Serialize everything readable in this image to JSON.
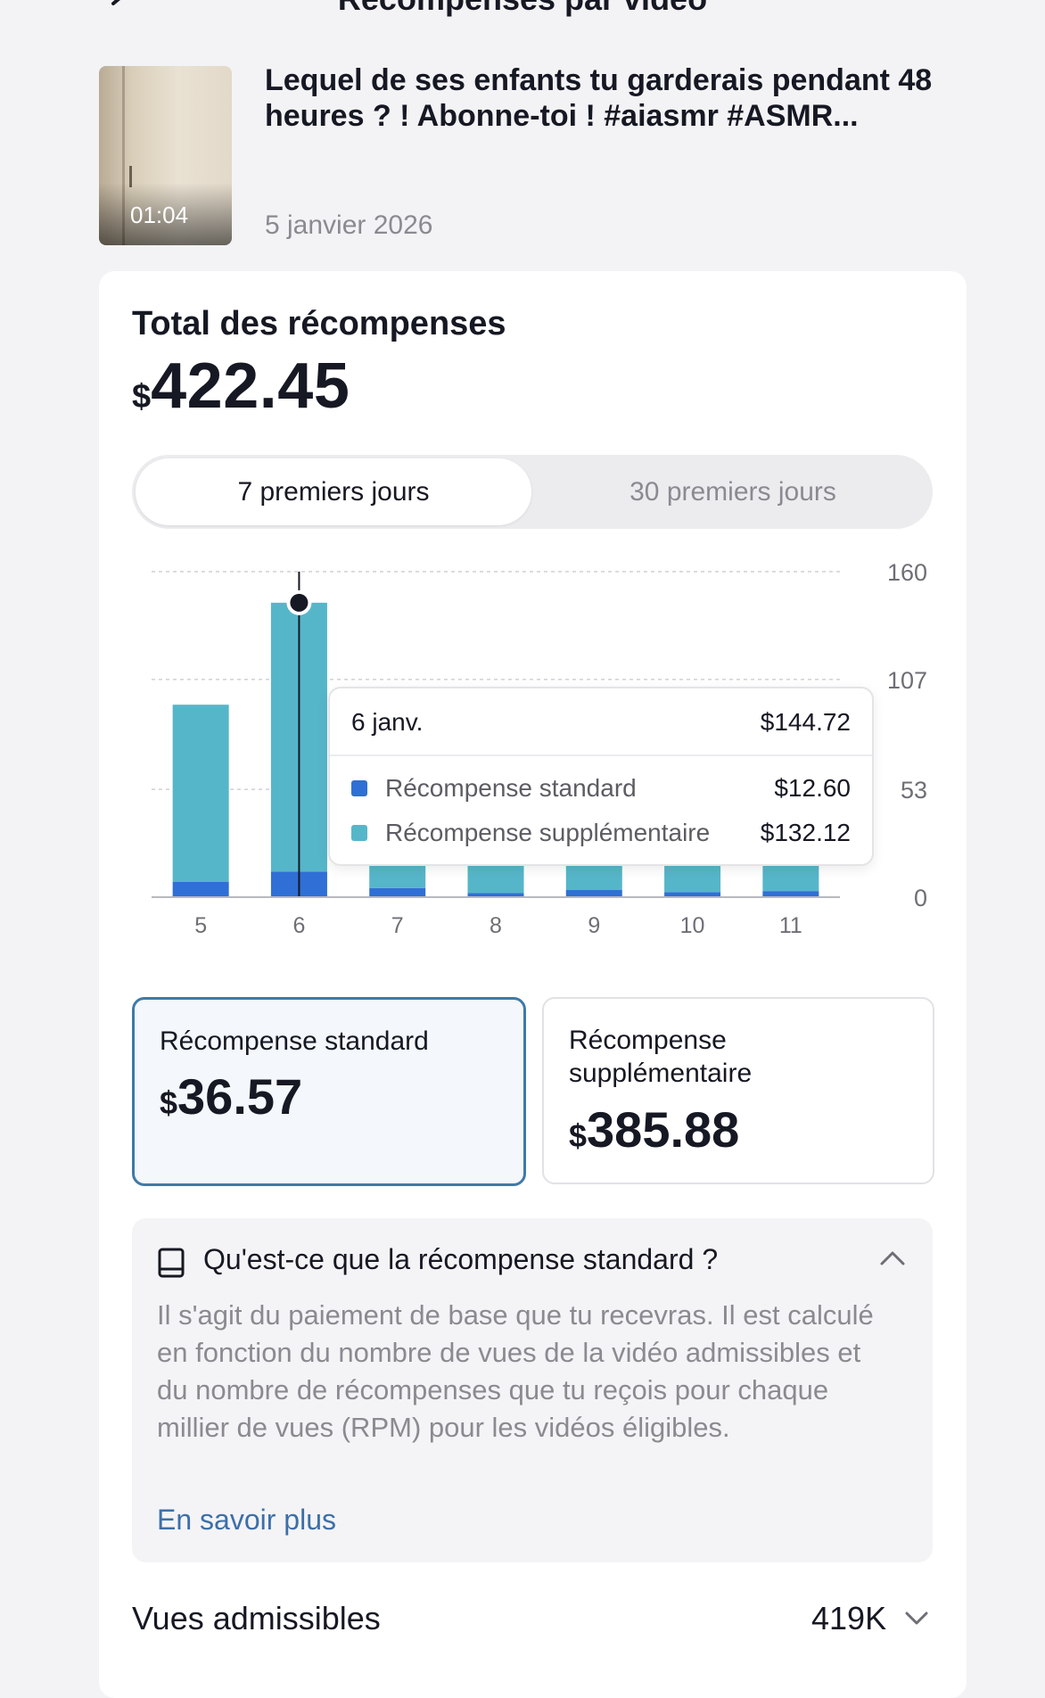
{
  "header": {
    "title": "Récompenses par vidéo"
  },
  "video": {
    "duration": "01:04",
    "title": "Lequel de ses enfants tu garderais pendant 48 heures ? ! Abonne-toi ! #aiasmr #ASMR...",
    "date": "5 janvier 2026"
  },
  "total": {
    "label": "Total des récompenses",
    "currency": "$",
    "amount": "422.45"
  },
  "tabs": {
    "first": "7 premiers jours",
    "second": "30 premiers jours",
    "selected": "7 premiers jours"
  },
  "chart_data": {
    "type": "bar",
    "stacked": true,
    "categories": [
      "5",
      "6",
      "7",
      "8",
      "9",
      "10",
      "11"
    ],
    "series": [
      {
        "name": "Récompense standard",
        "color": "#2f6fd6",
        "values": [
          7.6,
          12.6,
          4.5,
          2.0,
          3.5,
          2.5,
          3.0
        ]
      },
      {
        "name": "Récompense supplémentaire",
        "color": "#56b6c9",
        "values": [
          87.0,
          132.12,
          12.0,
          14.0,
          13.0,
          14.0,
          13.0
        ]
      }
    ],
    "y_ticks": [
      "160",
      "107",
      "53",
      "0"
    ],
    "ylim": [
      0,
      160
    ],
    "y_axis_side": "right",
    "grid": true,
    "highlighted_category": "6"
  },
  "tooltip": {
    "date": "6 janv.",
    "total": "$144.72",
    "rows": [
      {
        "label": "Récompense standard",
        "value": "$12.60",
        "color": "#2f6fd6"
      },
      {
        "label": "Récompense supplémentaire",
        "value": "$132.12",
        "color": "#56b6c9"
      }
    ]
  },
  "rewards": {
    "standard": {
      "label": "Récompense standard",
      "currency": "$",
      "amount": "36.57"
    },
    "supplementary": {
      "label_line1": "Récompense",
      "label_line2": "supplémentaire",
      "currency": "$",
      "amount": "385.88"
    }
  },
  "info": {
    "title": "Qu'est-ce que la récompense standard ?",
    "body": "Il s'agit du paiement de base que tu recevras. Il est calculé en fonction du nombre de vues de la vidéo admissibles et du nombre de récompenses que tu reçois pour chaque millier de vues (RPM) pour les vidéos éligibles.",
    "link": "En savoir plus"
  },
  "views": {
    "label": "Vues admissibles",
    "value": "419K"
  }
}
